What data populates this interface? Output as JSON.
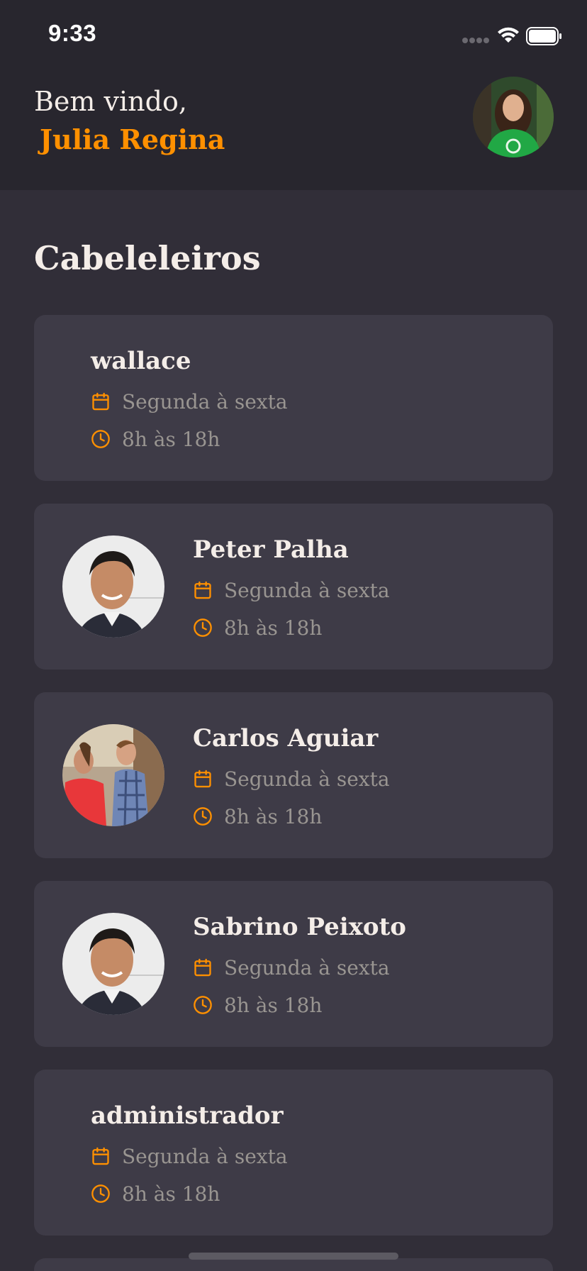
{
  "status_bar": {
    "time": "9:33"
  },
  "header": {
    "greeting": "Bem vindo,",
    "user_name": "Julia Regina",
    "avatar_icon": "user-avatar"
  },
  "section_title": "Cabeleleiros",
  "colors": {
    "background": "#312e38",
    "header": "#28262e",
    "card": "#3e3b47",
    "accent": "#ff9000",
    "text": "#f4ede8",
    "muted": "#999591"
  },
  "providers": [
    {
      "name": "wallace",
      "days": "Segunda à sexta",
      "hours": "8h às 18h",
      "has_avatar": false
    },
    {
      "name": "Peter Palha",
      "days": "Segunda à sexta",
      "hours": "8h às 18h",
      "has_avatar": true
    },
    {
      "name": "Carlos Aguiar",
      "days": "Segunda à sexta",
      "hours": "8h às 18h",
      "has_avatar": true
    },
    {
      "name": "Sabrino Peixoto",
      "days": "Segunda à sexta",
      "hours": "8h às 18h",
      "has_avatar": true
    },
    {
      "name": "administrador",
      "days": "Segunda à sexta",
      "hours": "8h às 18h",
      "has_avatar": false
    }
  ],
  "icons": {
    "days": "calendar-icon",
    "hours": "clock-icon"
  }
}
